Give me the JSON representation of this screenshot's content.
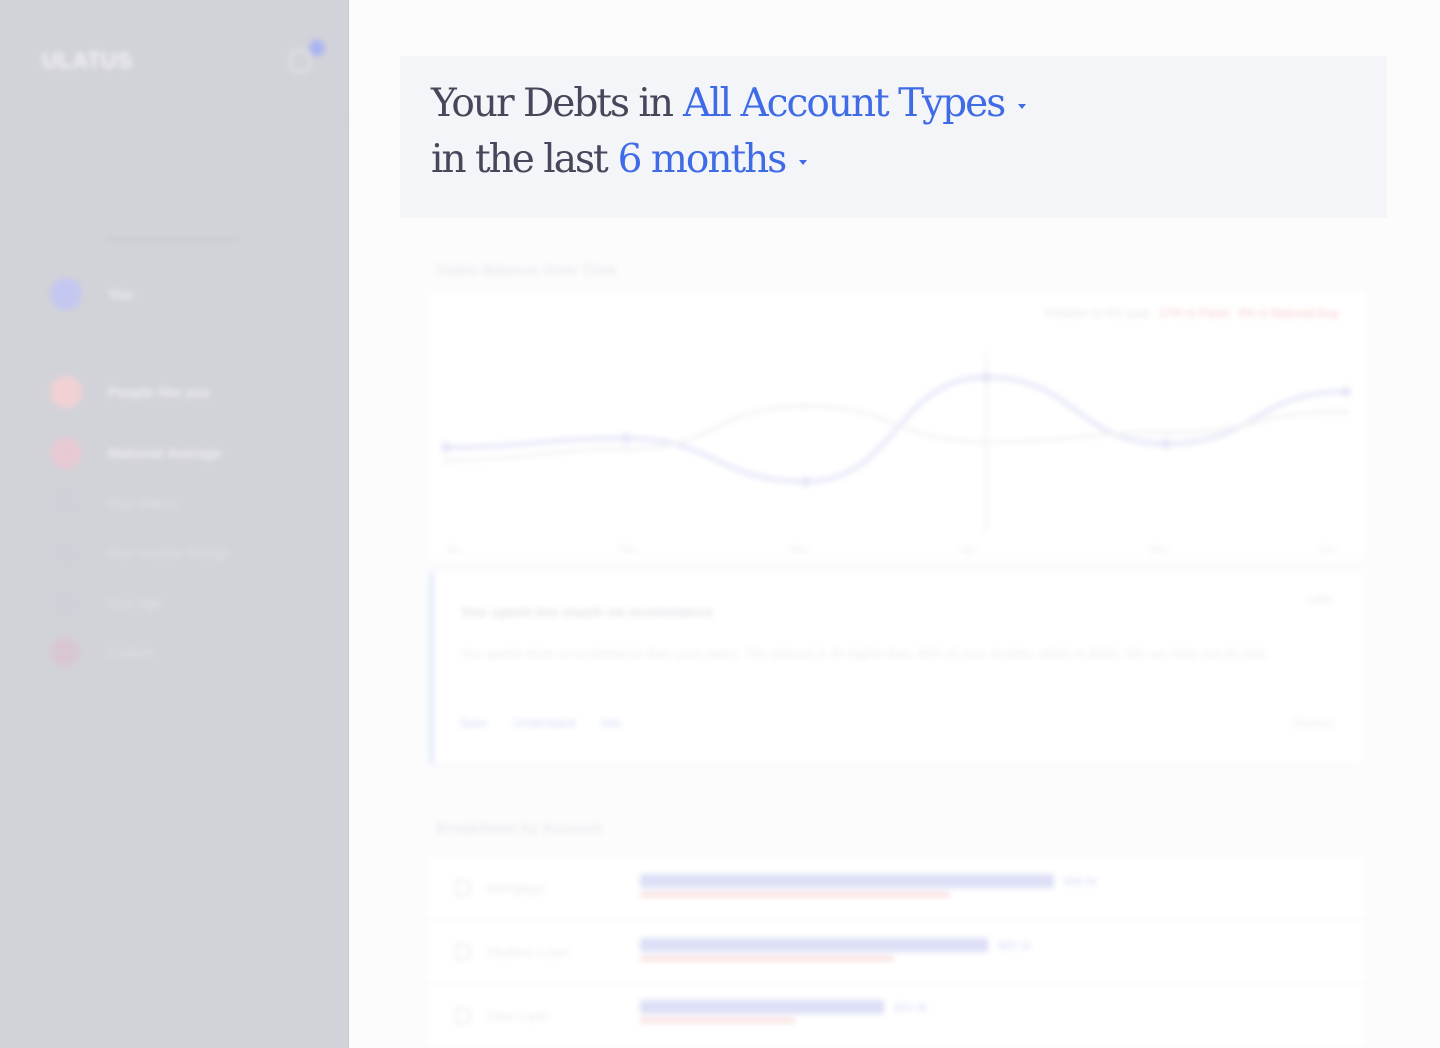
{
  "sidebar": {
    "brand": "ULATUS",
    "items": [
      {
        "label": "You",
        "color": "#c4c7f0"
      },
      {
        "label": "People like you",
        "color": "#f1d1d3"
      },
      {
        "label": "National Average",
        "color": "#e6c9d3"
      },
      {
        "label": "Your Wants",
        "color": "#d0d1d8"
      },
      {
        "label": "Your Income Range",
        "color": "#d0d1d8"
      },
      {
        "label": "Your Age",
        "color": "#d0d1d8"
      },
      {
        "label": "Custom",
        "color": "#d8c7d1"
      }
    ]
  },
  "header": {
    "prefix1": "Your Debts in",
    "account_type": "All Account Types",
    "prefix2": "in the last",
    "period": "6 months"
  },
  "balance_section": {
    "title": "Debts Balance Over Time",
    "legend_prefix": "Relative to this year",
    "legend_a": "17% in Panel",
    "legend_b": "4% in National Avg",
    "x_ticks": [
      "Jan",
      "Feb",
      "Mar",
      "Apr",
      "May",
      "Jun"
    ]
  },
  "chart_data": {
    "type": "line",
    "categories": [
      "Jan",
      "Feb",
      "Mar",
      "Apr",
      "May",
      "Jun"
    ],
    "series": [
      {
        "values": [
          47,
          52,
          28,
          86,
          49,
          78
        ],
        "color": "#e3e5f7"
      },
      {
        "values": [
          40,
          46,
          70,
          50,
          55,
          67
        ],
        "color": "#f2f2f5"
      }
    ],
    "ylim": [
      0,
      100
    ]
  },
  "insight": {
    "title": "You spent too much on ecommerce",
    "later": "Later",
    "body": "You spend more on ecommerce than your peers. The amount is 3x higher than 35% of your income, which is $420. We can help you do that.",
    "actions": [
      "Save",
      "Understand",
      "Info"
    ],
    "dismiss": "Dismiss"
  },
  "breakdown_section": {
    "title": "Breakdown by Account",
    "rows": [
      {
        "name": "Mortgage",
        "value": "$98.5k",
        "blue": 0.88,
        "red": 0.66
      },
      {
        "name": "Student Loan",
        "value": "$85.1k",
        "blue": 0.74,
        "red": 0.54
      },
      {
        "name": "Visa Card",
        "value": "$55.4k",
        "blue": 0.52,
        "red": 0.33
      }
    ]
  }
}
